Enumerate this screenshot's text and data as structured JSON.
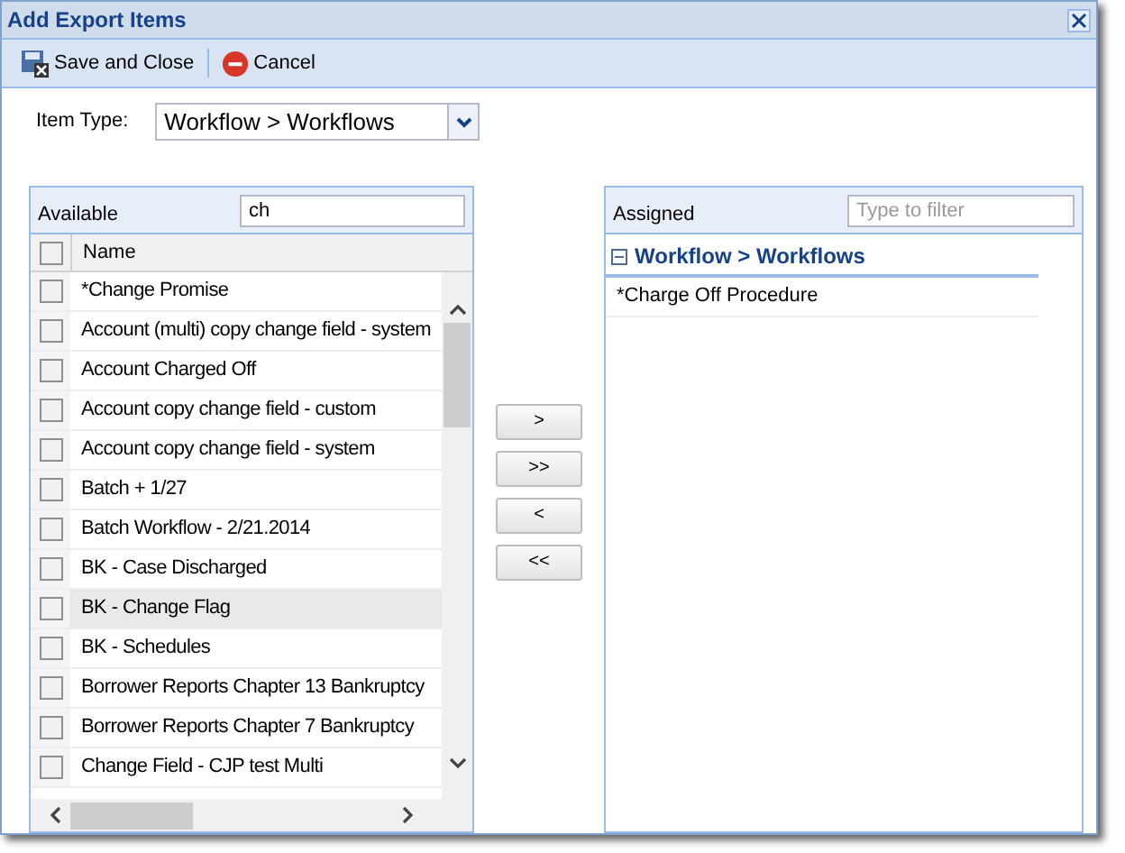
{
  "window": {
    "title": "Add Export Items"
  },
  "toolbar": [
    {
      "kind": "save",
      "label": "Save and Close"
    },
    {
      "kind": "cancel",
      "label": "Cancel"
    }
  ],
  "item_type": {
    "label": "Item Type:",
    "value": "Workflow > Workflows"
  },
  "available": {
    "title": "Available",
    "filter_value": "ch",
    "column": "Name",
    "header_checked": false,
    "rows": [
      {
        "name": "*Change Promise",
        "checked": false,
        "selected": false
      },
      {
        "name": "Account (multi) copy change field - system",
        "checked": false,
        "selected": false
      },
      {
        "name": "Account Charged Off",
        "checked": false,
        "selected": false
      },
      {
        "name": "Account copy change field - custom",
        "checked": false,
        "selected": false
      },
      {
        "name": "Account copy change field - system",
        "checked": false,
        "selected": false
      },
      {
        "name": "Batch + 1/27",
        "checked": false,
        "selected": false
      },
      {
        "name": "Batch Workflow - 2/21.2014",
        "checked": false,
        "selected": false
      },
      {
        "name": "BK - Case Discharged",
        "checked": false,
        "selected": false
      },
      {
        "name": "BK - Change Flag",
        "checked": false,
        "selected": true
      },
      {
        "name": "BK - Schedules",
        "checked": false,
        "selected": false
      },
      {
        "name": "Borrower Reports Chapter 13 Bankruptcy",
        "checked": false,
        "selected": false
      },
      {
        "name": "Borrower Reports Chapter 7 Bankruptcy",
        "checked": false,
        "selected": false
      },
      {
        "name": "Change Field - CJP test Multi",
        "checked": false,
        "selected": false
      }
    ]
  },
  "move_buttons": [
    ">",
    ">>",
    "<",
    "<<"
  ],
  "assigned": {
    "title": "Assigned",
    "filter_placeholder": "Type to filter",
    "groups": [
      {
        "label": "Workflow > Workflows",
        "expanded": true,
        "children": [
          {
            "name": "*Charge Off Procedure"
          }
        ]
      }
    ]
  }
}
